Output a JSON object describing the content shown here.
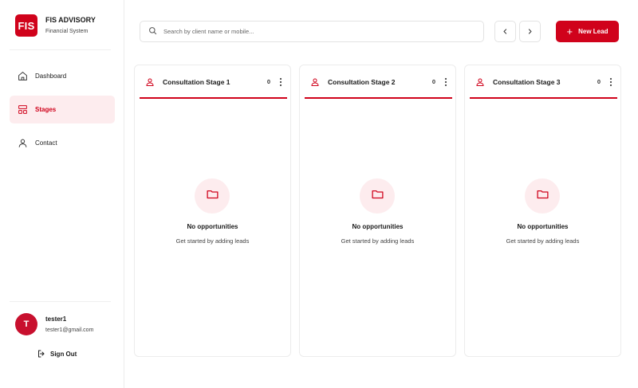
{
  "brand": {
    "logo": "FIS",
    "title": "FIS ADVISORY",
    "subtitle": "Financial System"
  },
  "nav": [
    {
      "label": "Dashboard",
      "icon": "home-icon",
      "active": false
    },
    {
      "label": "Stages",
      "icon": "stages-icon",
      "active": true
    },
    {
      "label": "Contact",
      "icon": "person-icon",
      "active": false
    }
  ],
  "user": {
    "initial": "T",
    "name": "tester1",
    "email": "tester1@gmail.com"
  },
  "signout": {
    "label": "Sign Out"
  },
  "search": {
    "placeholder": "Search by client name or mobile..."
  },
  "toolbar": {
    "new_lead_label": "New Lead"
  },
  "colors": {
    "accent": "#d0021b",
    "accent_light": "#fdecee"
  },
  "columns": [
    {
      "title": "Consultation Stage 1",
      "count": "0",
      "empty_title": "No opportunities",
      "empty_subtitle": "Get started by adding leads"
    },
    {
      "title": "Consultation Stage 2",
      "count": "0",
      "empty_title": "No opportunities",
      "empty_subtitle": "Get started by adding leads"
    },
    {
      "title": "Consultation Stage 3",
      "count": "0",
      "empty_title": "No opportunities",
      "empty_subtitle": "Get started by adding leads"
    }
  ]
}
